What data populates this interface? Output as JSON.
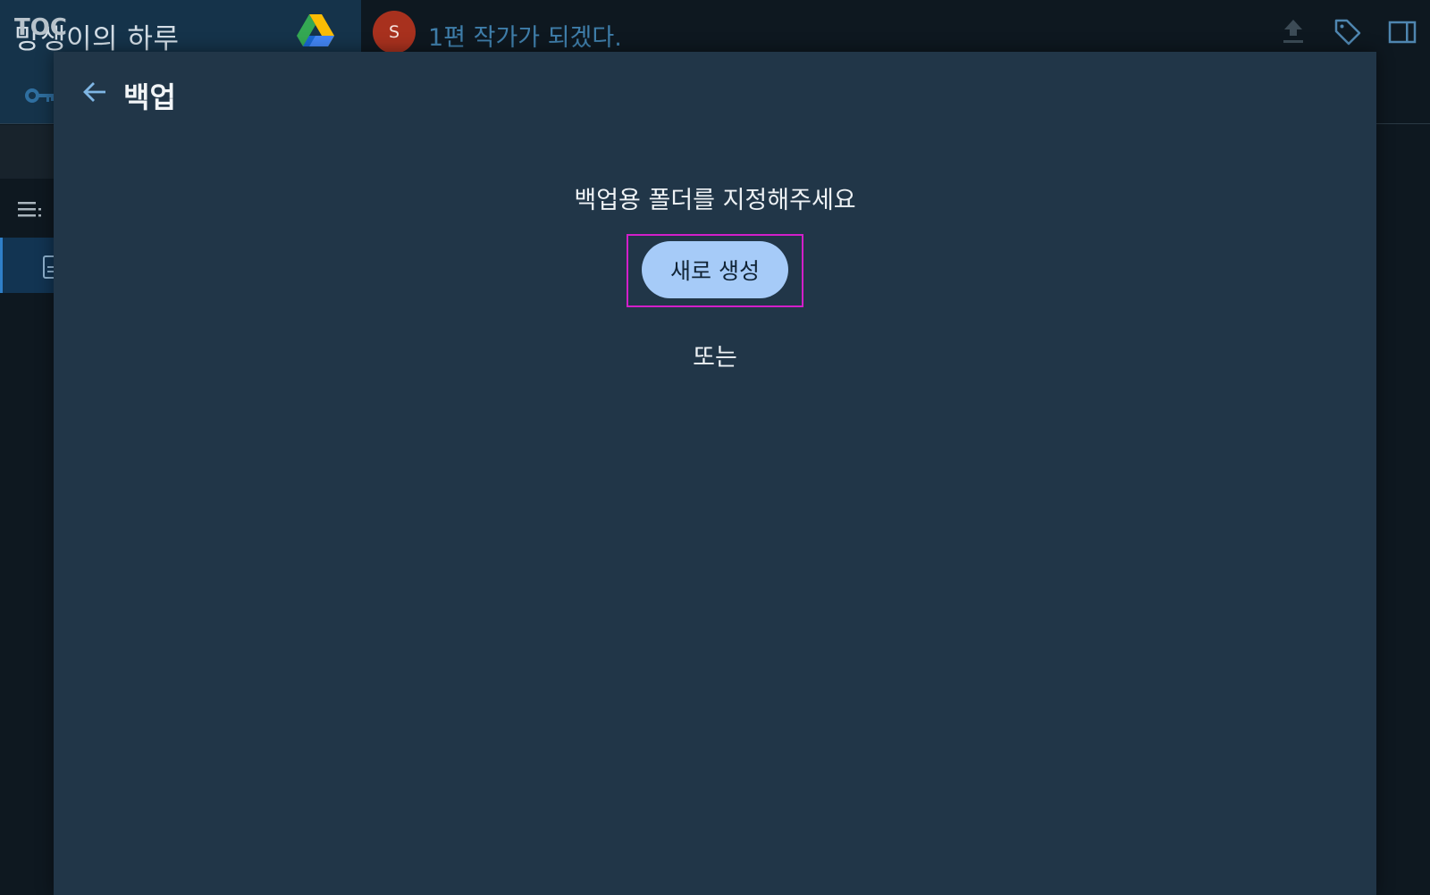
{
  "sidebar": {
    "title": "망생이의 하루",
    "toc_label": "TOC"
  },
  "topbar": {
    "avatar_letter": "S",
    "document_title": "1편 작가가 되겠다."
  },
  "dialog": {
    "title": "백업",
    "prompt": "백업용 폴더를 지정해주세요",
    "create_button": "새로 생성",
    "or_text": "또는"
  },
  "colors": {
    "dialog_background": "#213648",
    "button_fill": "#a6cbf8",
    "highlight_border": "#d21fc9",
    "avatar": "#a8311e"
  }
}
